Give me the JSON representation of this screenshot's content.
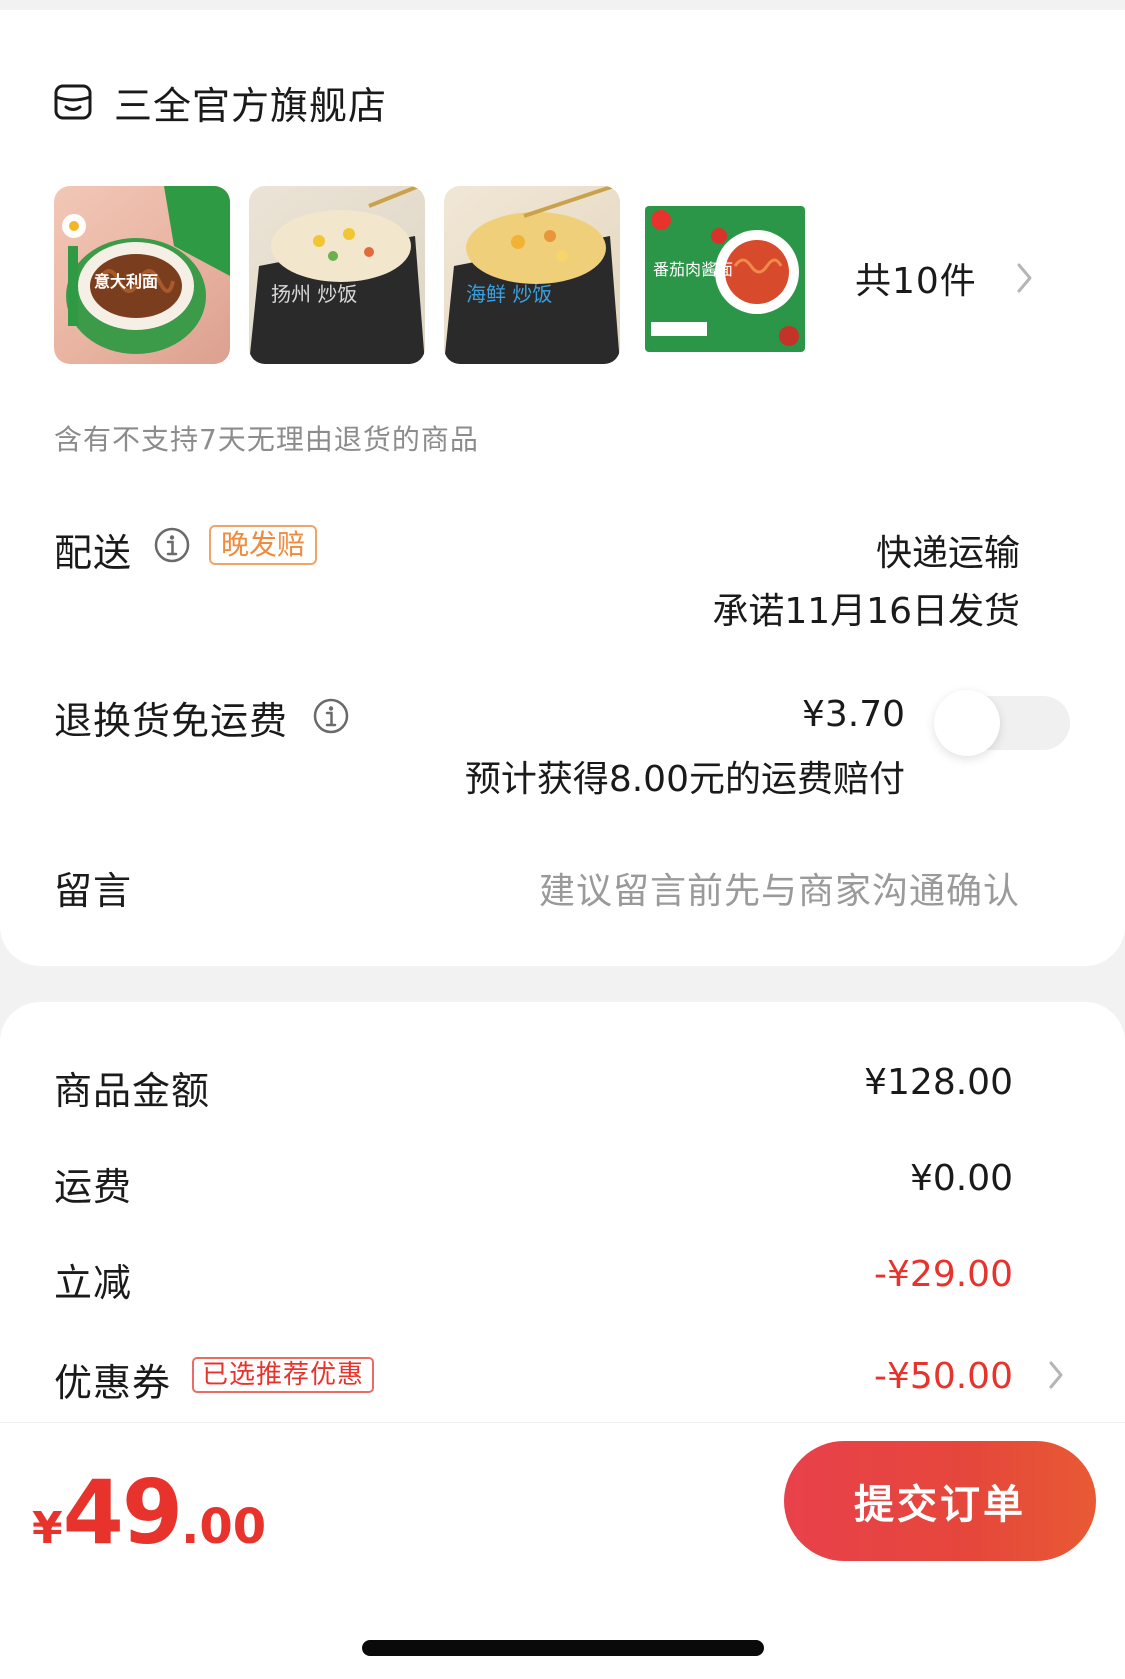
{
  "store": {
    "name": "三全官方旗舰店",
    "icon": "store-icon"
  },
  "products": {
    "items": [
      {
        "name": "意大利面",
        "packaging_text": "意大利面"
      },
      {
        "name": "扬州炒饭",
        "packaging_text": "扬州 炒饭"
      },
      {
        "name": "海鲜炒饭",
        "packaging_text": "海鲜 炒饭"
      },
      {
        "name": "番茄肉酱面",
        "packaging_text": "番茄肉酱面"
      }
    ],
    "count_label": "共10件"
  },
  "notice": "含有不支持7天无理由退货的商品",
  "delivery": {
    "label": "配送",
    "tag": "晚发赔",
    "method": "快递运输",
    "promise": "承诺11月16日发货"
  },
  "return_shipping": {
    "label": "退换货免运费",
    "price": "¥3.70",
    "description": "预计获得8.00元的运费赔付",
    "toggle_on": false
  },
  "message": {
    "label": "留言",
    "placeholder": "建议留言前先与商家沟通确认"
  },
  "price_summary": {
    "goods": {
      "label": "商品金额",
      "value": "¥128.00"
    },
    "shipping": {
      "label": "运费",
      "value": "¥0.00"
    },
    "discount": {
      "label": "立减",
      "value": "-¥29.00"
    },
    "coupon": {
      "label": "优惠券",
      "tag": "已选推荐优惠",
      "value": "-¥50.00"
    }
  },
  "footer": {
    "currency": "¥",
    "total_integer": "49",
    "total_decimal": ".00",
    "submit_label": "提交订单"
  },
  "colors": {
    "accent_red": "#e8332d",
    "tag_orange": "#f08a3c",
    "background": "#f2f2f2"
  }
}
